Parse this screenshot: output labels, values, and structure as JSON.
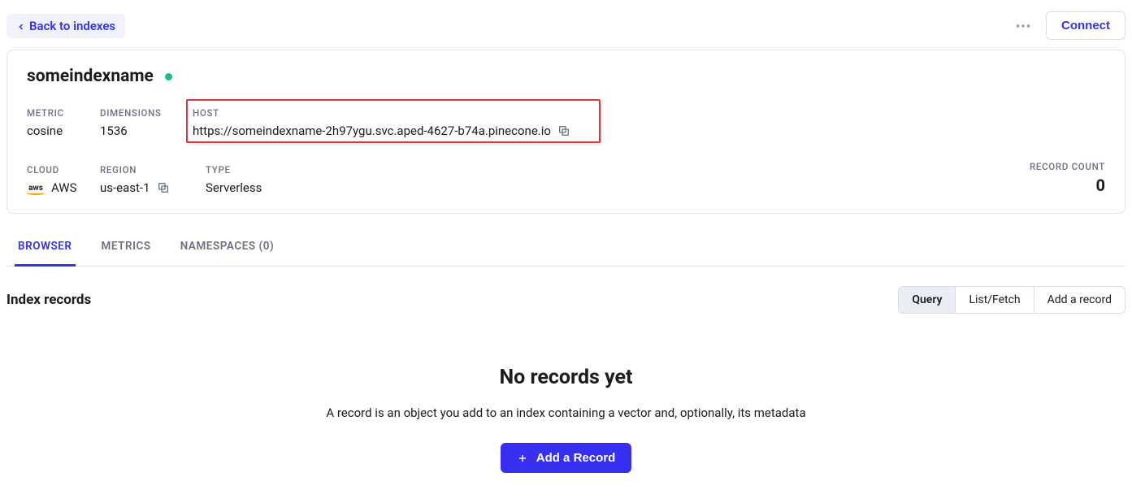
{
  "topbar": {
    "back_label": "Back to indexes",
    "connect_label": "Connect"
  },
  "index": {
    "name": "someindexname",
    "status": "ready",
    "labels": {
      "metric": "METRIC",
      "dimensions": "DIMENSIONS",
      "host": "HOST",
      "cloud": "CLOUD",
      "region": "REGION",
      "type": "TYPE",
      "record_count": "RECORD COUNT"
    },
    "metric": "cosine",
    "dimensions": "1536",
    "host": "https://someindexname-2h97ygu.svc.aped-4627-b74a.pinecone.io",
    "cloud": "AWS",
    "region": "us-east-1",
    "type": "Serverless",
    "record_count": "0"
  },
  "tabs": {
    "browser": "BROWSER",
    "metrics": "METRICS",
    "namespaces": "NAMESPACES (0)"
  },
  "records": {
    "section_title": "Index records",
    "segments": {
      "query": "Query",
      "list_fetch": "List/Fetch",
      "add": "Add a record"
    },
    "empty": {
      "title": "No records yet",
      "desc": "A record is an object you add to an index containing a vector and, optionally, its metadata",
      "cta": "Add a Record"
    }
  }
}
